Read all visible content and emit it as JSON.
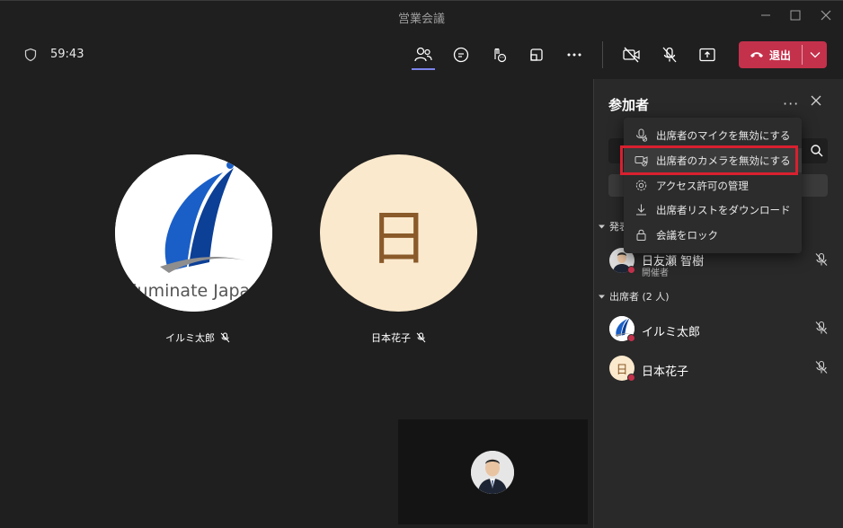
{
  "window": {
    "title": "営業会議"
  },
  "toolbar": {
    "timer": "59:43",
    "leave_label": "退出"
  },
  "stage": {
    "participants": [
      {
        "name": "イルミ太郎",
        "logo_text": "lluminate Japa"
      },
      {
        "name": "日本花子",
        "initial": "日"
      }
    ]
  },
  "panel": {
    "title": "参加者",
    "sections": [
      {
        "label": "発表",
        "count": ""
      },
      {
        "label": "出席者 (2 人)"
      }
    ],
    "organizer": {
      "name": "日友瀬 智樹",
      "role": "開催者"
    },
    "attendees": [
      {
        "name": "イルミ太郎"
      },
      {
        "name": "日本花子",
        "initial": "日"
      }
    ]
  },
  "menu": {
    "items": [
      {
        "label": "出席者のマイクを無効にする",
        "icon": "mic-icon"
      },
      {
        "label": "出席者のカメラを無効にする",
        "icon": "camera-icon"
      },
      {
        "label": "アクセス許可の管理",
        "icon": "gear-icon"
      },
      {
        "label": "出席者リストをダウンロード",
        "icon": "download-icon"
      },
      {
        "label": "会議をロック",
        "icon": "lock-icon"
      }
    ]
  },
  "colors": {
    "leave": "#c4314b",
    "highlight": "#d9202f",
    "accent": "#7b83eb"
  }
}
